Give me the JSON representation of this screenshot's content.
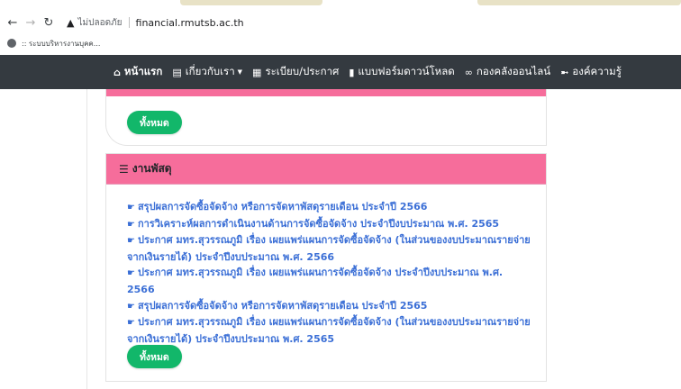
{
  "browser": {
    "not_secure": "ไม่ปลอดภัย",
    "url": "financial.rmutsb.ac.th",
    "bookmark": ":: ระบบบริหารงานบุคค..."
  },
  "nav": {
    "items": [
      {
        "label": "หน้าแรก",
        "icon": "home-icon"
      },
      {
        "label": "เกี่ยวกับเรา",
        "icon": "id-card-icon",
        "dropdown": true
      },
      {
        "label": "ระเบียบ/ประกาศ",
        "icon": "document-icon"
      },
      {
        "label": "แบบฟอร์มดาวน์โหลด",
        "icon": "file-icon"
      },
      {
        "label": "กองคลังออนไลน์",
        "icon": "link-icon"
      },
      {
        "label": "องค์ความรู้",
        "icon": "signpost-icon"
      }
    ]
  },
  "card_top": {
    "button_label": "ทั้งหมด"
  },
  "card_main": {
    "title": "งานพัสดุ",
    "icon": "coins-icon",
    "links": [
      "สรุปผลการจัดซื้อจัดจ้าง หรือการจัดหาพัสดุรายเดือน ประจำปี 2566",
      "การวิเคราะห์ผลการดำเนินงานด้านการจัดซื้อจัดจ้าง ประจำปีงบประมาณ พ.ศ. 2565",
      "ประกาศ มทร.สุวรรณภูมิ เรื่อง เผยแพร่แผนการจัดซื้อจัดจ้าง (ในส่วนของงบประมาณรายจ่ายจากเงินรายได้) ประจำปีงบประมาณ พ.ศ. 2566",
      "ประกาศ มทร.สุวรรณภูมิ เรื่อง เผยแพร่แผนการจัดซื้อจัดจ้าง ประจำปีงบประมาณ พ.ศ. 2566",
      "สรุปผลการจัดซื้อจัดจ้าง หรือการจัดหาพัสดุรายเดือน ประจำปี 2565",
      "ประกาศ มทร.สุวรรณภูมิ เรื่อง เผยแพร่แผนการจัดซื้อจัดจ้าง (ในส่วนของงบประมาณรายจ่ายจากเงินรายได้) ประจำปีงบประมาณ พ.ศ. 2565"
    ],
    "button_label": "ทั้งหมด"
  },
  "colors": {
    "nav_bg": "#343a40",
    "pink": "#f66d9b",
    "green": "#12b76a",
    "link": "#3b6fd6"
  }
}
